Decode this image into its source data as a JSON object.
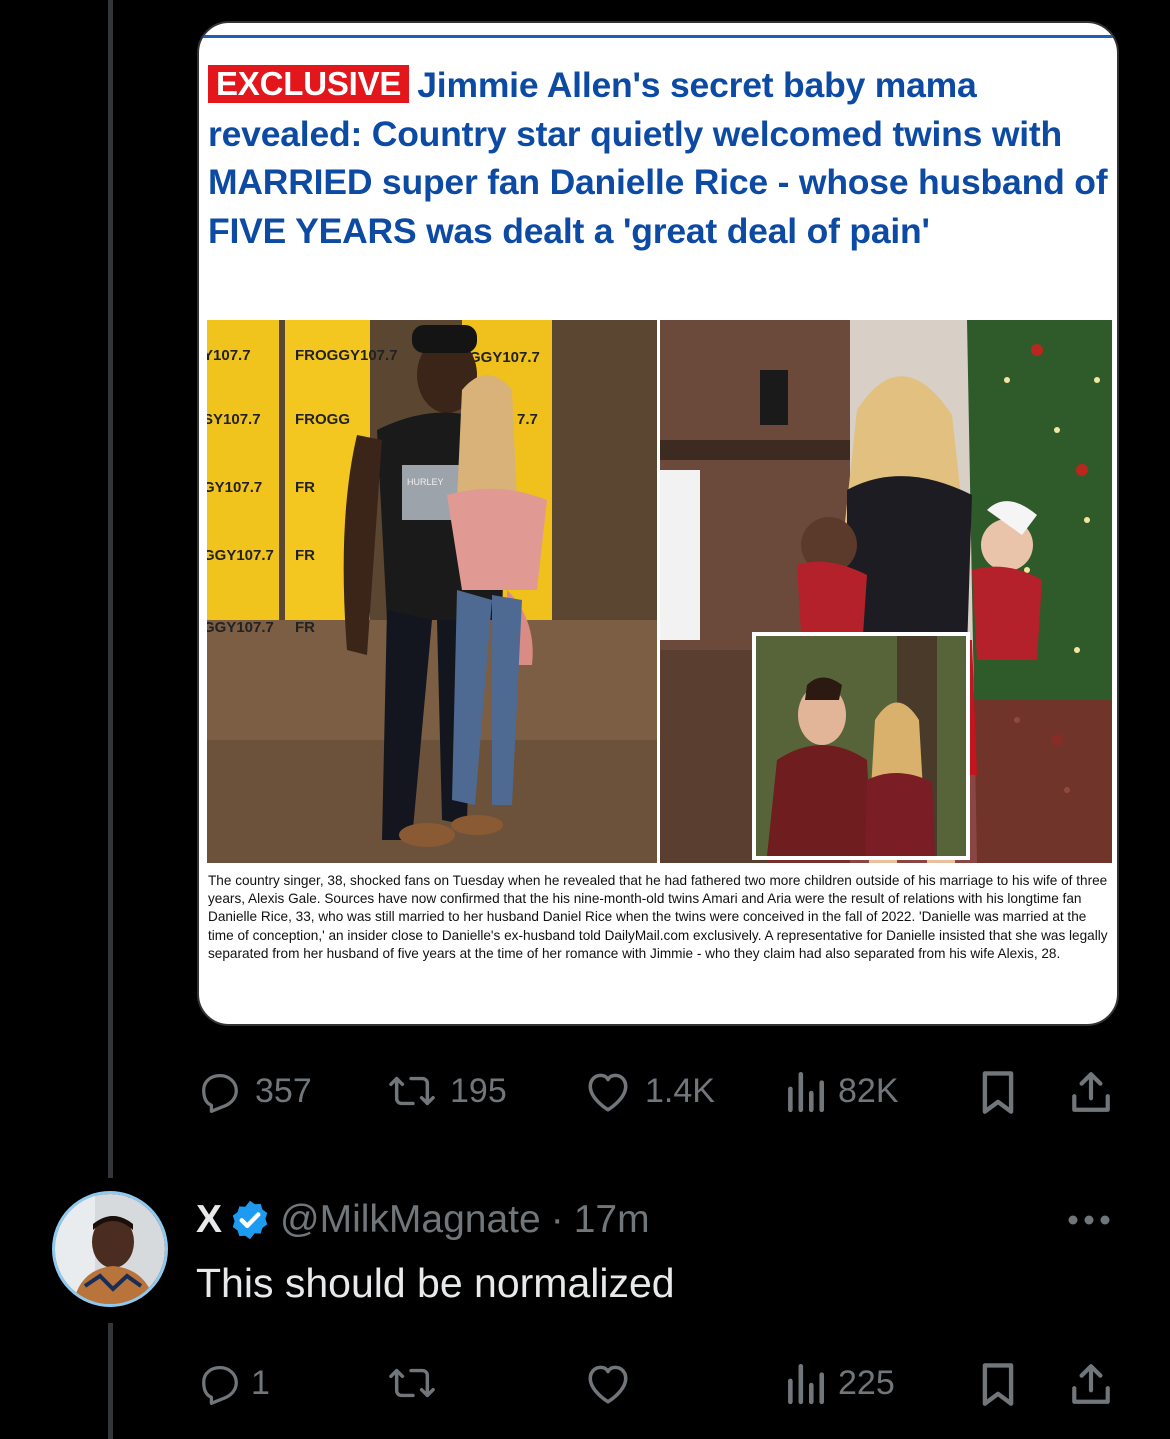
{
  "article": {
    "badge": "EXCLUSIVE",
    "headline": "Jimmie Allen's secret baby mama revealed: Country star quietly welcomed twins with MARRIED super fan Danielle Rice - whose husband of FIVE YEARS was dealt a 'great deal of pain'",
    "caption": "The country singer, 38, shocked fans on Tuesday when he revealed that he had fathered two more children outside of his marriage to his wife of three years, Alexis Gale. Sources have now confirmed that the his nine-month-old twins Amari and Aria were the result of relations with his longtime fan Danielle Rice, 33, who was still married to her husband Daniel Rice when the twins were conceived in the fall of 2022. 'Danielle was married at the time of conception,' an insider close to Danielle's ex-husband told DailyMail.com exclusively. A representative for Danielle insisted that she was legally separated from her husband of five years at the time of her romance with Jimmie - who they claim had also separated from his wife Alexis, 28.",
    "banner_text": [
      "Y107.7",
      "FROGGY107.7",
      "GGY107.7",
      "SY107.7",
      "FROGG",
      "7.7",
      "GY107.7",
      "FR",
      "GGY107.7",
      "FR",
      "GGY107.7",
      "FR"
    ],
    "shirt_text": "HURLEY"
  },
  "post_actions": {
    "replies": "357",
    "reposts": "195",
    "likes": "1.4K",
    "views": "82K"
  },
  "reply": {
    "name": "X",
    "handle": "@MilkMagnate",
    "separator": "·",
    "time": "17m",
    "text": "This should be normalized",
    "actions": {
      "replies": "1",
      "reposts": "",
      "likes": "",
      "views": "225"
    }
  },
  "colors": {
    "background": "#000000",
    "text": "#e7e9ea",
    "muted": "#71767b",
    "verified": "#1d9bf0",
    "headline_blue": "#0d4aa3",
    "badge_red": "#e2161b"
  }
}
